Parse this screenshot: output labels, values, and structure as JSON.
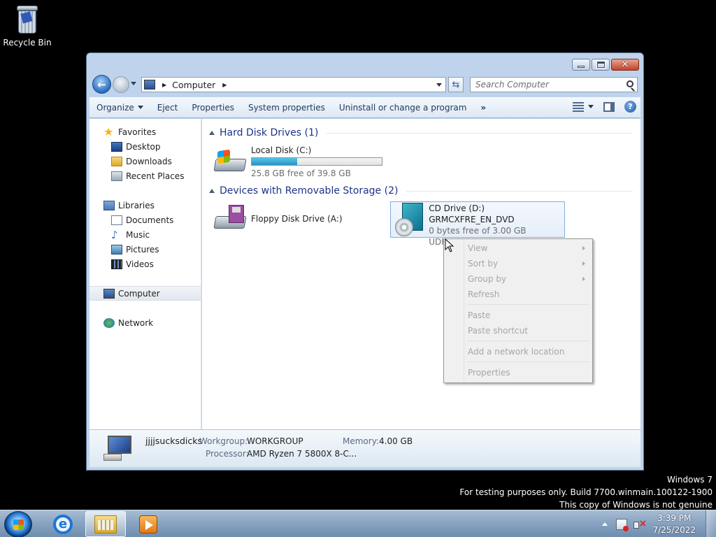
{
  "desktop": {
    "recycle_bin_label": "Recycle Bin"
  },
  "watermark": {
    "line1": "Windows 7",
    "line2": "For testing purposes only. Build 7700.winmain.100122-1900",
    "line3": "This copy of Windows is not genuine"
  },
  "window": {
    "address": {
      "crumb": "Computer"
    },
    "search": {
      "placeholder": "Search Computer"
    },
    "toolbar": {
      "organize": "Organize",
      "eject": "Eject",
      "properties": "Properties",
      "system_properties": "System properties",
      "uninstall": "Uninstall or change a program",
      "more": "»"
    },
    "nav": {
      "favorites": "Favorites",
      "desktop": "Desktop",
      "downloads": "Downloads",
      "recent_places": "Recent Places",
      "libraries": "Libraries",
      "documents": "Documents",
      "music": "Music",
      "pictures": "Pictures",
      "videos": "Videos",
      "computer": "Computer",
      "network": "Network"
    },
    "groups": {
      "hdd_header": "Hard Disk Drives (1)",
      "removable_header": "Devices with Removable Storage (2)"
    },
    "drives": {
      "local_disk": {
        "name": "Local Disk (C:)",
        "free": "25.8 GB free of 39.8 GB",
        "used_fraction": 0.35
      },
      "floppy": {
        "name": "Floppy Disk Drive (A:)"
      },
      "cd": {
        "name": "CD Drive (D:) GRMCXFRE_EN_DVD",
        "free": "0 bytes free of 3.00 GB",
        "fs": "UDF"
      }
    },
    "details": {
      "pc_name": "jjjjsucksdicks",
      "workgroup_label": "Workgroup:",
      "workgroup_value": "WORKGROUP",
      "memory_label": "Memory:",
      "memory_value": "4.00 GB",
      "processor_label": "Processor:",
      "processor_value": "AMD Ryzen 7 5800X 8-C..."
    }
  },
  "context_menu": {
    "view": "View",
    "sort_by": "Sort by",
    "group_by": "Group by",
    "refresh": "Refresh",
    "paste": "Paste",
    "paste_shortcut": "Paste shortcut",
    "add_network_location": "Add a network location",
    "properties": "Properties"
  },
  "taskbar": {
    "time": "3:39 PM",
    "date": "7/25/2022"
  }
}
